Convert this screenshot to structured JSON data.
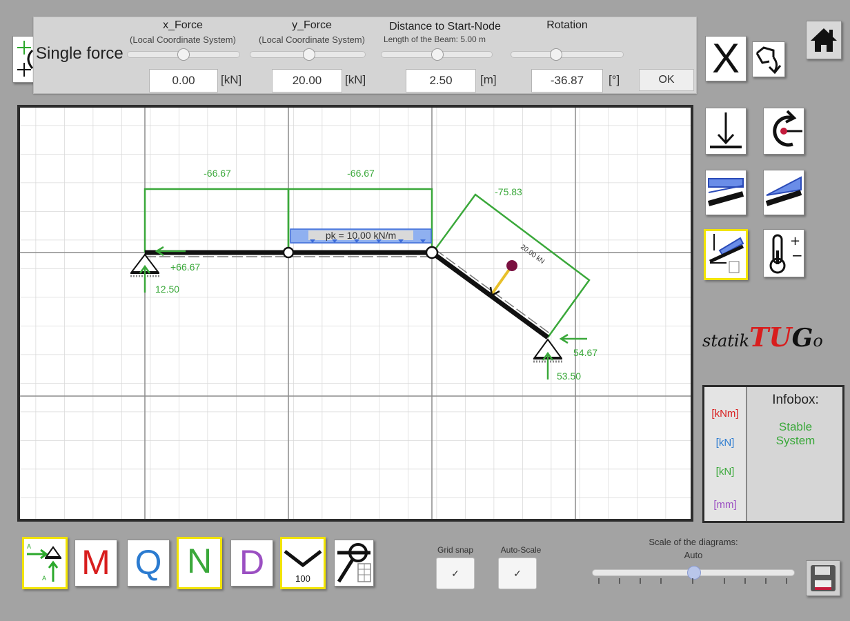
{
  "panel": {
    "title": "Single force",
    "x_force": {
      "label": "x_Force",
      "sub": "(Local Coordinate System)",
      "value": "0.00",
      "unit": "[kN]"
    },
    "y_force": {
      "label": "y_Force",
      "sub": "(Local Coordinate System)",
      "value": "20.00",
      "unit": "[kN]"
    },
    "distance": {
      "label": "Distance to Start-Node",
      "sub": "Length of the Beam: 5.00 m",
      "value": "2.50",
      "unit": "[m]"
    },
    "rotation": {
      "label": "Rotation",
      "value": "-36.87",
      "unit": "[°]"
    },
    "ok_label": "OK"
  },
  "canvas": {
    "labels": {
      "n1": "-66.67",
      "n2": "-66.67",
      "n3": "-75.83",
      "load": "pk = 10.00 kN/m",
      "force": "20.00 kN",
      "left_h": "+66.67",
      "left_v": "12.50",
      "right_h": "54.67",
      "right_v": "53.50"
    }
  },
  "right_toolbar": {
    "close_label": "X"
  },
  "logo": {
    "a": "statik",
    "b": "TU",
    "c": "G",
    "d": "o"
  },
  "infobox": {
    "title": "Infobox:",
    "status_line1": "Stable",
    "status_line2": "System",
    "units": [
      "[kNm]",
      "[kN]",
      "[kN]",
      "[mm]"
    ]
  },
  "bottom_toolbar": {
    "m_label": "M",
    "q_label": "Q",
    "n_label": "N",
    "d_label": "D",
    "deform_label": "100",
    "grid_snap_label": "Grid snap",
    "auto_scale_label": "Auto-Scale",
    "check_mark": "✓",
    "scale_label": "Scale of the diagrams:",
    "scale_value": "Auto",
    "scale_fraction": 0.5
  },
  "colors": {
    "normal_force": "#3aa83a",
    "moment": "#d81e1e",
    "shear": "#2b7bd0",
    "deflection": "#9b4fc2",
    "highlight": "#f2e400"
  }
}
